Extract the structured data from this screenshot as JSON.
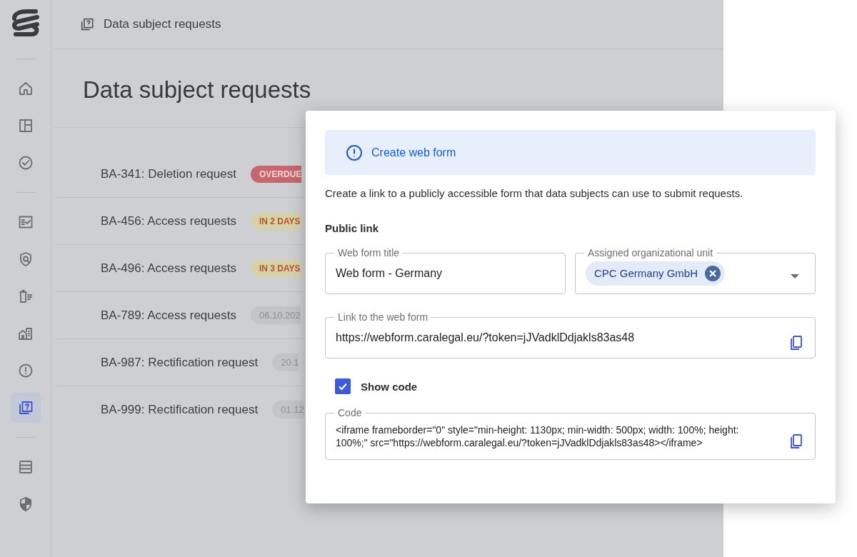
{
  "sidebar": {
    "items": [
      {
        "kind": "home",
        "selected": false
      },
      {
        "kind": "layout",
        "selected": false
      },
      {
        "kind": "check",
        "selected": false
      },
      {
        "kind": "divider"
      },
      {
        "kind": "checklist",
        "selected": false
      },
      {
        "kind": "shield-search",
        "selected": false
      },
      {
        "kind": "trash-list",
        "selected": false
      },
      {
        "kind": "buildings",
        "selected": false
      },
      {
        "kind": "alert",
        "selected": false
      },
      {
        "kind": "requests",
        "selected": true
      },
      {
        "kind": "divider"
      },
      {
        "kind": "table",
        "selected": false
      },
      {
        "kind": "shield",
        "selected": false
      }
    ]
  },
  "breadcrumb": "Data subject requests",
  "title": "Data subject requests",
  "requests": [
    {
      "name": "BA-341: Deletion request",
      "badge": "OVERDUE",
      "kind": "overdue"
    },
    {
      "name": "BA-456: Access requests",
      "badge": "IN 2 DAYS",
      "kind": "soon"
    },
    {
      "name": "BA-496: Access requests",
      "badge": "IN 3 DAYS",
      "kind": "soon"
    },
    {
      "name": "BA-789: Access requests",
      "badge": "06.10.202",
      "kind": "date"
    },
    {
      "name": "BA-987: Rectification request",
      "badge": "20.1",
      "kind": "date"
    },
    {
      "name": "BA-999: Rectification request",
      "badge": "01.12",
      "kind": "date"
    }
  ],
  "dialog": {
    "banner": "Create web form",
    "description": "Create a link to a publicly accessible form that data subjects can use to submit requests.",
    "section": "Public link",
    "title_field": {
      "label": "Web form title",
      "value": "Web form - Germany"
    },
    "unit_field": {
      "label": "Assigned organizational unit",
      "chip": "CPC Germany GmbH"
    },
    "link_field": {
      "label": "Link to the web form",
      "value": "https://webform.caralegal.eu/?token=jJVadklDdjakls83as48"
    },
    "show_code": {
      "label": "Show code",
      "checked": true
    },
    "code_field": {
      "label": "Code",
      "value": "<iframe frameborder=\"0\" style=\"min-height: 1130px; min-width: 500px; width: 100%; height: 100%;\" src=\"https://webform.caralegal.eu/?token=jJVadklDdjakls83as48></iframe>"
    }
  }
}
